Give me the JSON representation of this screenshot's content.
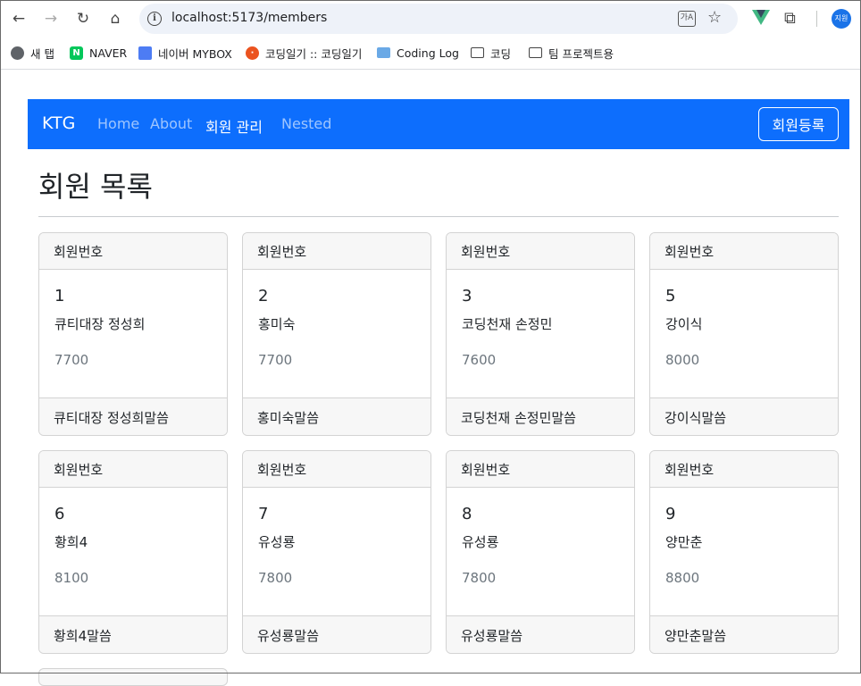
{
  "browser": {
    "url": "localhost:5173/members",
    "profile_label": "지원",
    "bookmarks": [
      {
        "label": "새 탭",
        "icon": "globe-icon"
      },
      {
        "label": "NAVER",
        "icon": "naver-icon"
      },
      {
        "label": "네이버 MYBOX",
        "icon": "mybox-icon"
      },
      {
        "label": "코딩일기 :: 코딩일기",
        "icon": "tistory-icon"
      },
      {
        "label": "Coding Log",
        "icon": "monitor-icon"
      },
      {
        "label": "코딩",
        "icon": "folder-icon"
      },
      {
        "label": "팀 프로젝트용",
        "icon": "folder-icon"
      }
    ]
  },
  "navbar": {
    "brand": "KTG",
    "links": [
      "Home",
      "About",
      "회원 관리",
      "Nested"
    ],
    "active_link": "회원 관리",
    "register_button": "회원등록",
    "color": "#0d6efd"
  },
  "page": {
    "title": "회원 목록"
  },
  "members": [
    {
      "header": "회원번호",
      "id": "1",
      "name": "큐티대장 정성희",
      "salary": "7700",
      "footer": "큐티대장 정성희말씀"
    },
    {
      "header": "회원번호",
      "id": "2",
      "name": "홍미숙",
      "salary": "7700",
      "footer": "홍미숙말씀"
    },
    {
      "header": "회원번호",
      "id": "3",
      "name": "코딩천재 손정민",
      "salary": "7600",
      "footer": "코딩천재 손정민말씀"
    },
    {
      "header": "회원번호",
      "id": "5",
      "name": "강이식",
      "salary": "8000",
      "footer": "강이식말씀"
    },
    {
      "header": "회원번호",
      "id": "6",
      "name": "황희4",
      "salary": "8100",
      "footer": "황희4말씀"
    },
    {
      "header": "회원번호",
      "id": "7",
      "name": "유성룡",
      "salary": "7800",
      "footer": "유성룡말씀"
    },
    {
      "header": "회원번호",
      "id": "8",
      "name": "유성룡",
      "salary": "7800",
      "footer": "유성룡말씀"
    },
    {
      "header": "회원번호",
      "id": "9",
      "name": "양만춘",
      "salary": "8800",
      "footer": "양만춘말씀"
    }
  ]
}
